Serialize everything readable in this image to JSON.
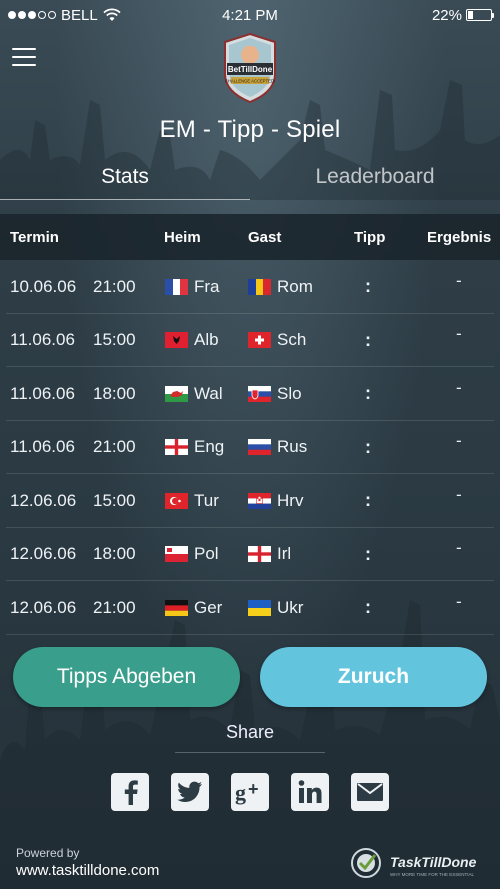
{
  "status": {
    "carrier": "BELL",
    "time": "4:21 PM",
    "battery": "22%",
    "battery_level": 0.22,
    "signal_bars": 3
  },
  "header": {
    "logo_text": "BetTillDone",
    "logo_sub": "CHALLENGE ACCEPTED!",
    "title": "EM - Tipp - Spiel"
  },
  "tabs": [
    {
      "label": "Stats",
      "active": true
    },
    {
      "label": "Leaderboard",
      "active": false
    }
  ],
  "table": {
    "headers": [
      "Termin",
      "Heim",
      "Gast",
      "Tipp",
      "Ergebnis"
    ],
    "rows": [
      {
        "date": "10.06.06",
        "time": "21:00",
        "home": "Fra",
        "home_flag": "france",
        "away": "Rom",
        "away_flag": "romania",
        "tipp": ":",
        "result": "-"
      },
      {
        "date": "11.06.06",
        "time": "15:00",
        "home": "Alb",
        "home_flag": "albania",
        "away": "Sch",
        "away_flag": "switzerland",
        "tipp": ":",
        "result": "-"
      },
      {
        "date": "11.06.06",
        "time": "18:00",
        "home": "Wal",
        "home_flag": "wales",
        "away": "Slo",
        "away_flag": "slovakia",
        "tipp": ":",
        "result": "-"
      },
      {
        "date": "11.06.06",
        "time": "21:00",
        "home": "Eng",
        "home_flag": "england",
        "away": "Rus",
        "away_flag": "russia",
        "tipp": ":",
        "result": "-"
      },
      {
        "date": "12.06.06",
        "time": "15:00",
        "home": "Tur",
        "home_flag": "turkey",
        "away": "Hrv",
        "away_flag": "croatia",
        "tipp": ":",
        "result": "-"
      },
      {
        "date": "12.06.06",
        "time": "18:00",
        "home": "Pol",
        "home_flag": "poland",
        "away": "Irl",
        "away_flag": "england",
        "tipp": ":",
        "result": "-"
      },
      {
        "date": "12.06.06",
        "time": "21:00",
        "home": "Ger",
        "home_flag": "germany",
        "away": "Ukr",
        "away_flag": "ukraine",
        "tipp": ":",
        "result": "-"
      }
    ]
  },
  "buttons": {
    "submit": "Tipps Abgeben",
    "back": "Zuruch"
  },
  "share": {
    "label": "Share",
    "icons": [
      "facebook-icon",
      "twitter-icon",
      "google-plus-icon",
      "linkedin-icon",
      "mail-icon"
    ]
  },
  "footer": {
    "powered_by": "Powered by",
    "url": "www.tasktilldone.com",
    "brand": "TaskTillDone",
    "brand_tagline": "WHY MORE TIME FOR THE ESSENTIAL"
  },
  "colors": {
    "accent_green": "#3a9e8c",
    "accent_blue": "#63c4dd",
    "background": "#27363f"
  }
}
